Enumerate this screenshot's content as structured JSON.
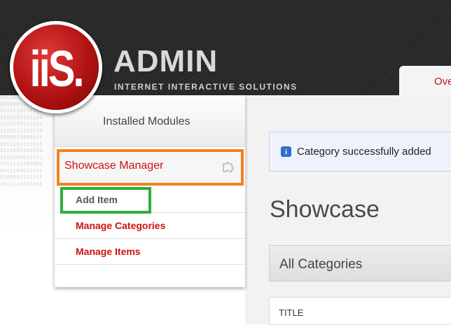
{
  "header": {
    "logo_text": "iiS.",
    "brand_title": "ADMIN",
    "brand_subtitle": "INTERNET INTERACTIVE SOLUTIONS",
    "top_tab_label": "Overview"
  },
  "sidebar": {
    "header": "Installed Modules",
    "module": {
      "label": "Showcase Manager",
      "icon": "puzzle-icon"
    },
    "items": [
      {
        "label": "Add Item"
      },
      {
        "label": "Manage Categories"
      },
      {
        "label": "Manage Items"
      }
    ]
  },
  "main": {
    "alert_text": "Category successfully added",
    "alert_icon": "info-icon",
    "page_title": "Showcase",
    "filter_value": "All Categories",
    "table_header": "TITLE"
  },
  "colors": {
    "accent_red": "#cc1111",
    "highlight_orange": "#f2821e",
    "highlight_green": "#2fae3b",
    "info_blue": "#2f6fc9"
  }
}
